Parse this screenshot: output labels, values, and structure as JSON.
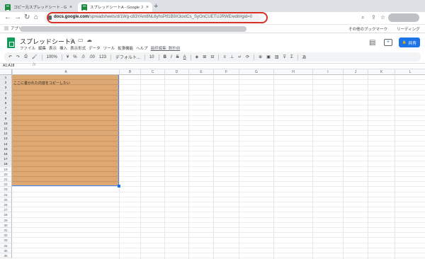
{
  "browser": {
    "tabs": [
      {
        "title": "コピー元スプレッドシート - Goog",
        "close": "×"
      },
      {
        "title": "スプレッドシートA - Google ス",
        "close": "×"
      }
    ],
    "new_tab": "+",
    "nav": {
      "back": "←",
      "forward": "→",
      "reload": "↻",
      "home": "⌂"
    },
    "url_host": "docs.google.com",
    "url_path": "/spreadsheets/d/1Wg-c83YAm8NL6yhsPtf1B9X3oxtCs_SyOnCUETUJRWE/edit#gid=0",
    "icons": {
      "zoom": "⌕",
      "share": "⇪",
      "star": "☆"
    },
    "bookmarks": {
      "apps": "アプリ",
      "other": "その他のブックマーク",
      "reading_list": "リーディング"
    }
  },
  "sheets": {
    "title": "スプレッドシートA",
    "title_icons": {
      "star": "☆",
      "move": "▭",
      "cloud": "☁"
    },
    "menu": [
      "ファイル",
      "編集",
      "表示",
      "挿入",
      "表示形式",
      "データ",
      "ツール",
      "拡張機能",
      "ヘルプ"
    ],
    "last_edit": "最終編集: 数秒前",
    "comment_icon": "▤",
    "meet_icon": "+",
    "share_label": "共有",
    "share_icon": "🔒",
    "toolbar": {
      "undo": "↶",
      "redo": "↷",
      "print": "⎙",
      "paint_format": "🖌",
      "zoom": "100%",
      "currency": "¥",
      "percent": "%",
      "decimal_dec": ".0",
      "decimal_inc": ".00",
      "more_formats": "123",
      "font": "デフォルト...",
      "font_size": "10",
      "bold": "B",
      "italic": "I",
      "strike": "S",
      "text_color": "A",
      "fill": "◈",
      "borders": "⊞",
      "merge": "⊟",
      "halign": "≡",
      "valign": "⊥",
      "wrap": "↵",
      "rotate": "⟳",
      "link": "⊕",
      "comment": "▣",
      "chart": "▥",
      "filter": "⊽",
      "functions": "Σ",
      "input_tools": "あ"
    },
    "name_box": "A1:A18",
    "fx": "fx",
    "columns": [
      "A",
      "B",
      "C",
      "D",
      "E",
      "F",
      "G",
      "H",
      "I",
      "J",
      "K",
      "L"
    ],
    "rows": [
      "1",
      "2",
      "3",
      "4",
      "5",
      "6",
      "7",
      "8",
      "9",
      "10",
      "11",
      "12",
      "13",
      "14",
      "15",
      "16",
      "17",
      "18",
      "19",
      "20",
      "21",
      "22",
      "23",
      "24",
      "25",
      "26",
      "27",
      "28",
      "29",
      "30",
      "31",
      "32",
      "33",
      "34",
      "35",
      "36"
    ],
    "cell_text": "ここに書かれた内容をコピーしたい"
  }
}
